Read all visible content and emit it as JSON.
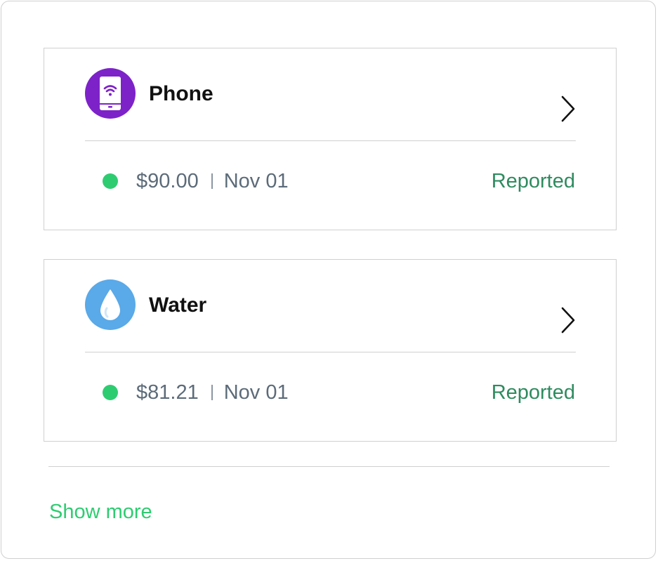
{
  "colors": {
    "status_green": "#2ecc71",
    "status_text_green": "#2e8b5f",
    "link_green": "#2ecc71",
    "phone_purple": "#7d22c9",
    "water_blue": "#5aa9e8"
  },
  "bills": [
    {
      "title": "Phone",
      "icon": "phone-wifi-icon",
      "amount": "$90.00",
      "date": "Nov 01",
      "status": "Reported"
    },
    {
      "title": "Water",
      "icon": "water-drop-icon",
      "amount": "$81.21",
      "date": "Nov 01",
      "status": "Reported"
    }
  ],
  "footer": {
    "show_more_label": "Show more"
  }
}
